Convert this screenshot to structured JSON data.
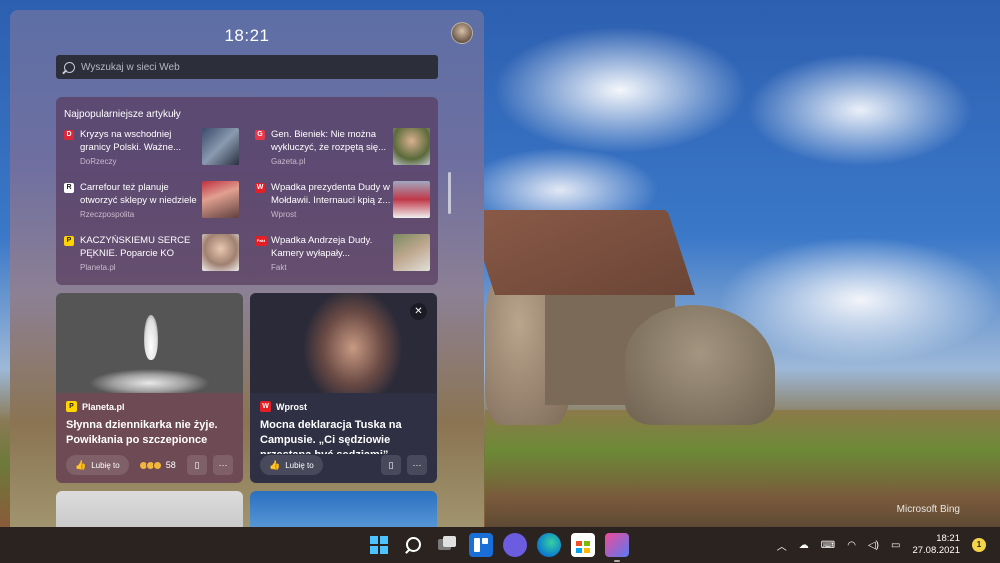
{
  "panel": {
    "time": "18:21",
    "search_placeholder": "Wyszukaj w sieci Web"
  },
  "top_articles": {
    "title": "Najpopularniejsze artykuły",
    "items": [
      {
        "title": "Kryzys na wschodniej granicy Polski. Ważne...",
        "source": "DoRzeczy",
        "logo": "D",
        "logo_bg": "#d8283a",
        "logo_fg": "#ffffff"
      },
      {
        "title": "Gen. Bieniek: Nie można wykluczyć, że rozpętą się...",
        "source": "Gazeta.pl",
        "logo": "G",
        "logo_bg": "#e8364a",
        "logo_fg": "#ffffff"
      },
      {
        "title": "Carrefour też planuje otworzyć sklepy w niedziele",
        "source": "Rzeczpospolita",
        "logo": "R",
        "logo_bg": "#ffffff",
        "logo_fg": "#222222"
      },
      {
        "title": "Wpadka prezydenta Dudy w Mołdawii. Internauci kpią z...",
        "source": "Wprost",
        "logo": "W",
        "logo_bg": "#e31e24",
        "logo_fg": "#ffffff"
      },
      {
        "title": "KACZYŃSKIEMU SERCE PĘKNIE. Poparcie KO rośnie...",
        "source": "Planeta.pl",
        "logo": "P",
        "logo_bg": "#ffd400",
        "logo_fg": "#222222"
      },
      {
        "title": "Wpadka Andrzeja Dudy. Kamery wyłapały...",
        "source": "Fakt",
        "logo": "Fakt",
        "logo_bg": "#e31e24",
        "logo_fg": "#ffffff"
      }
    ]
  },
  "cards": [
    {
      "source": "Planeta.pl",
      "logo": "P",
      "logo_bg": "#ffd400",
      "logo_fg": "#222222",
      "title": "Słynna dziennikarka nie żyje. Powikłania po szczepionce",
      "like_label": "Lubię to",
      "reaction_count": "58"
    },
    {
      "source": "Wprost",
      "logo": "W",
      "logo_bg": "#e31e24",
      "logo_fg": "#ffffff",
      "title": "Mocna deklaracja Tuska na Campusie. „Ci sędziowie przestaną być sędziami”",
      "like_label": "Lubię to"
    }
  ],
  "desktop": {
    "watermark": "Microsoft Bing"
  },
  "taskbar": {
    "apps": [
      "start-icon",
      "search-icon",
      "task-view-icon",
      "widgets-icon",
      "chat-icon",
      "edge-icon",
      "store-icon",
      "photos-icon"
    ],
    "clock_time": "18:21",
    "clock_date": "27.08.2021",
    "notification_count": "1"
  }
}
